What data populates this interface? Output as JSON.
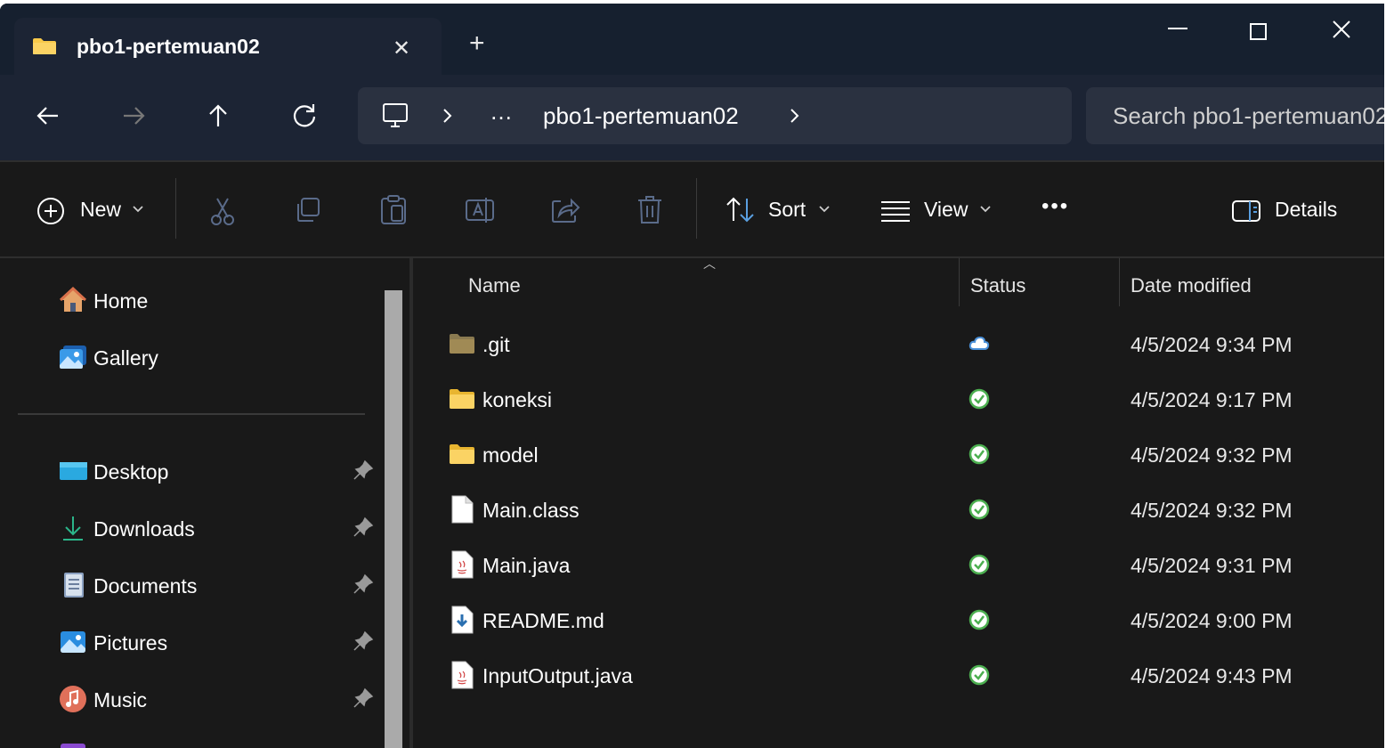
{
  "titlebar": {
    "tab_title": "pbo1-pertemuan02",
    "tab_close": "✕",
    "new_tab": "+"
  },
  "navbar": {
    "address_segments": [
      "…",
      "pbo1-pertemuan02"
    ],
    "search_placeholder": "Search pbo1-pertemuan02"
  },
  "commandbar": {
    "new_label": "New",
    "sort_label": "Sort",
    "view_label": "View",
    "more_label": "•••",
    "details_label": "Details"
  },
  "sidebar": {
    "top_items": [
      {
        "label": "Home",
        "icon": "home-icon"
      },
      {
        "label": "Gallery",
        "icon": "gallery-icon"
      }
    ],
    "quick_access": [
      {
        "label": "Desktop",
        "icon": "desktop-icon",
        "pinned": true
      },
      {
        "label": "Downloads",
        "icon": "downloads-icon",
        "pinned": true
      },
      {
        "label": "Documents",
        "icon": "documents-icon",
        "pinned": true
      },
      {
        "label": "Pictures",
        "icon": "pictures-icon",
        "pinned": true
      },
      {
        "label": "Music",
        "icon": "music-icon",
        "pinned": true
      }
    ]
  },
  "list": {
    "columns": [
      "Name",
      "Status",
      "Date modified"
    ],
    "rows": [
      {
        "name": ".git",
        "type": "folder-hidden",
        "status": "cloud",
        "date": "4/5/2024 9:34 PM"
      },
      {
        "name": "koneksi",
        "type": "folder",
        "status": "synced",
        "date": "4/5/2024 9:17 PM"
      },
      {
        "name": "model",
        "type": "folder",
        "status": "synced",
        "date": "4/5/2024 9:32 PM"
      },
      {
        "name": "Main.class",
        "type": "file",
        "status": "synced",
        "date": "4/5/2024 9:32 PM"
      },
      {
        "name": "Main.java",
        "type": "java",
        "status": "synced",
        "date": "4/5/2024 9:31 PM"
      },
      {
        "name": "README.md",
        "type": "md",
        "status": "synced",
        "date": "4/5/2024 9:00 PM"
      },
      {
        "name": "InputOutput.java",
        "type": "java",
        "status": "synced",
        "date": "4/5/2024 9:43 PM"
      }
    ]
  },
  "colors": {
    "titlebar_bg": "#16202f",
    "navbar_bg": "#1c2434",
    "content_bg": "#191919",
    "folder_yellow": "#f8c94a",
    "status_green": "#4caf50",
    "cloud_blue": "#4a90d9"
  }
}
